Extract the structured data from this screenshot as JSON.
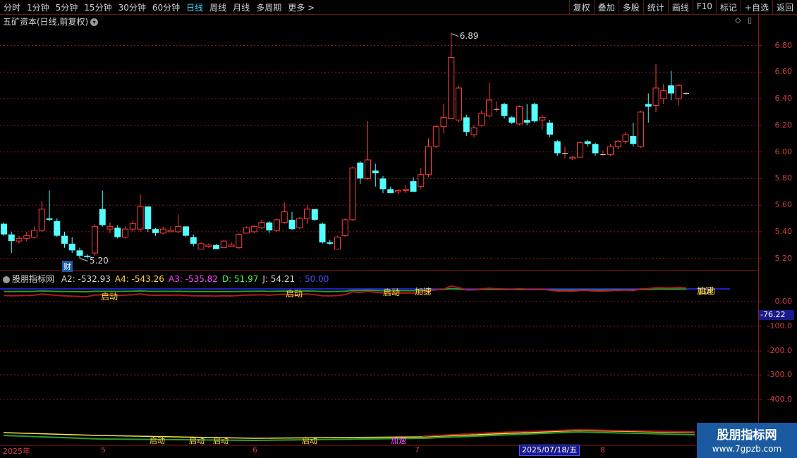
{
  "toolbar": {
    "periods": [
      "分时",
      "1分钟",
      "5分钟",
      "15分钟",
      "30分钟",
      "60分钟",
      "日线",
      "周线",
      "月线",
      "多周期",
      "更多 >"
    ],
    "active_period": "日线",
    "actions": [
      "复权",
      "叠加",
      "多股",
      "统计",
      "画线",
      "F10",
      "标记",
      "+自选",
      "返回"
    ]
  },
  "main_chart": {
    "title": "五矿资本(日线,前复权)",
    "high_label": "6.89",
    "low_label": "5.20",
    "badge": "财",
    "y_labels": [
      "6.80",
      "6.60",
      "6.40",
      "6.20",
      "6.00",
      "5.80",
      "5.60",
      "5.40",
      "5.20"
    ]
  },
  "indicator": {
    "name": "股朋指标网",
    "values": [
      {
        "text": "A2: -532.93",
        "color": "#d8d8d8"
      },
      {
        "text": "A4: -543.26",
        "color": "#ffd84a"
      },
      {
        "text": "A3: -535.82",
        "color": "#ff4aff"
      },
      {
        "text": "D: 51.97",
        "color": "#3fff3f"
      },
      {
        "text": "J: 54.21",
        "color": "#d8d8d8"
      },
      {
        "text": ": 50.00",
        "color": "#4a4aff"
      }
    ],
    "y_labels": [
      "0.00",
      "-100.0",
      "-200.0",
      "-300.0",
      "-400.0"
    ],
    "cursor_value": "-76.22",
    "signals": [
      "启动",
      "启动",
      "启动",
      "加速",
      "加速",
      "启动"
    ]
  },
  "weekly_signals": [
    "启动",
    "启动",
    "启动",
    "启动",
    "加速"
  ],
  "date_axis": {
    "labels": [
      "2025年",
      "5",
      "6",
      "7",
      "8"
    ],
    "cursor_date": "2025/07/18/五"
  },
  "watermark": {
    "name": "股朋指标网",
    "url": "www.7gpzb.com"
  },
  "colors": {
    "up": "#ff3c3c",
    "down": "#54ffff",
    "grid": "#8a1a1a"
  },
  "chart_data": {
    "type": "candlestick",
    "ylim": [
      5.14,
      6.93
    ],
    "candles": [
      [
        5.46,
        5.38,
        5.47,
        5.37
      ],
      [
        5.38,
        5.33,
        5.4,
        5.24
      ],
      [
        5.33,
        5.35,
        5.37,
        5.31
      ],
      [
        5.35,
        5.37,
        5.4,
        5.33
      ],
      [
        5.36,
        5.41,
        5.44,
        5.35
      ],
      [
        5.41,
        5.57,
        5.63,
        5.4
      ],
      [
        5.5,
        5.49,
        5.71,
        5.48
      ],
      [
        5.48,
        5.37,
        5.5,
        5.36
      ],
      [
        5.37,
        5.31,
        5.4,
        5.28
      ],
      [
        5.31,
        5.26,
        5.36,
        5.24
      ],
      [
        5.26,
        5.22,
        5.28,
        5.2
      ],
      [
        5.22,
        5.21,
        5.23,
        5.2
      ],
      [
        5.24,
        5.44,
        5.46,
        5.22
      ],
      [
        5.57,
        5.45,
        5.71,
        5.44
      ],
      [
        5.42,
        5.44,
        5.47,
        5.39
      ],
      [
        5.43,
        5.36,
        5.45,
        5.35
      ],
      [
        5.36,
        5.42,
        5.44,
        5.35
      ],
      [
        5.42,
        5.46,
        5.48,
        5.4
      ],
      [
        5.42,
        5.59,
        5.68,
        5.4
      ],
      [
        5.59,
        5.42,
        5.59,
        5.4
      ],
      [
        5.42,
        5.39,
        5.43,
        5.37
      ],
      [
        5.39,
        5.42,
        5.44,
        5.38
      ],
      [
        5.4,
        5.41,
        5.44,
        5.4
      ],
      [
        5.4,
        5.44,
        5.53,
        5.39
      ],
      [
        5.44,
        5.37,
        5.44,
        5.36
      ],
      [
        5.36,
        5.31,
        5.38,
        5.29
      ],
      [
        5.27,
        5.31,
        5.32,
        5.27
      ],
      [
        5.29,
        5.3,
        5.31,
        5.28
      ],
      [
        5.3,
        5.27,
        5.31,
        5.27
      ],
      [
        5.28,
        5.33,
        5.34,
        5.28
      ],
      [
        5.29,
        5.3,
        5.32,
        5.29
      ],
      [
        5.28,
        5.38,
        5.39,
        5.27
      ],
      [
        5.39,
        5.43,
        5.44,
        5.39
      ],
      [
        5.4,
        5.44,
        5.45,
        5.39
      ],
      [
        5.43,
        5.47,
        5.49,
        5.42
      ],
      [
        5.47,
        5.41,
        5.48,
        5.39
      ],
      [
        5.41,
        5.49,
        5.5,
        5.4
      ],
      [
        5.47,
        5.55,
        5.62,
        5.46
      ],
      [
        5.49,
        5.42,
        5.55,
        5.41
      ],
      [
        5.43,
        5.5,
        5.51,
        5.42
      ],
      [
        5.5,
        5.57,
        5.6,
        5.46
      ],
      [
        5.57,
        5.49,
        5.57,
        5.48
      ],
      [
        5.46,
        5.32,
        5.47,
        5.31
      ],
      [
        5.32,
        5.31,
        5.34,
        5.3
      ],
      [
        5.27,
        5.36,
        5.37,
        5.27
      ],
      [
        5.37,
        5.49,
        5.5,
        5.36
      ],
      [
        5.49,
        5.88,
        5.89,
        5.48
      ],
      [
        5.92,
        5.8,
        5.93,
        5.76
      ],
      [
        5.8,
        5.94,
        6.23,
        5.79
      ],
      [
        5.86,
        5.84,
        5.91,
        5.74
      ],
      [
        5.8,
        5.72,
        5.82,
        5.69
      ],
      [
        5.72,
        5.69,
        5.74,
        5.69
      ],
      [
        5.7,
        5.71,
        5.72,
        5.68
      ],
      [
        5.71,
        5.72,
        5.75,
        5.69
      ],
      [
        5.78,
        5.7,
        5.81,
        5.7
      ],
      [
        5.74,
        5.83,
        5.88,
        5.72
      ],
      [
        5.83,
        6.04,
        6.1,
        5.81
      ],
      [
        6.04,
        6.19,
        6.2,
        6.03
      ],
      [
        6.19,
        6.26,
        6.36,
        6.14
      ],
      [
        6.25,
        6.71,
        6.89,
        6.25
      ],
      [
        6.24,
        6.48,
        6.5,
        6.22
      ],
      [
        6.26,
        6.15,
        6.28,
        6.12
      ],
      [
        6.13,
        6.18,
        6.2,
        6.11
      ],
      [
        6.2,
        6.29,
        6.31,
        6.19
      ],
      [
        6.27,
        6.39,
        6.52,
        6.26
      ],
      [
        6.32,
        6.32,
        6.38,
        6.3
      ],
      [
        6.36,
        6.27,
        6.37,
        6.25
      ],
      [
        6.26,
        6.22,
        6.27,
        6.21
      ],
      [
        6.21,
        6.34,
        6.35,
        6.2
      ],
      [
        6.24,
        6.22,
        6.36,
        6.2
      ],
      [
        6.36,
        6.23,
        6.37,
        6.22
      ],
      [
        6.24,
        6.26,
        6.28,
        6.17
      ],
      [
        6.22,
        6.13,
        6.24,
        6.11
      ],
      [
        6.08,
        5.99,
        6.09,
        5.97
      ],
      [
        5.99,
        5.99,
        6.04,
        5.95
      ],
      [
        5.95,
        5.96,
        5.97,
        5.94
      ],
      [
        5.96,
        6.07,
        6.08,
        5.96
      ],
      [
        6.08,
        6.06,
        6.09,
        6.04
      ],
      [
        6.06,
        5.99,
        6.07,
        5.97
      ],
      [
        5.98,
        5.98,
        6.01,
        5.97
      ],
      [
        5.98,
        6.04,
        6.06,
        5.97
      ],
      [
        6.04,
        6.08,
        6.09,
        6.02
      ],
      [
        6.08,
        6.13,
        6.15,
        6.06
      ],
      [
        6.12,
        6.06,
        6.22,
        6.04
      ],
      [
        6.04,
        6.3,
        6.31,
        6.03
      ],
      [
        6.36,
        6.34,
        6.44,
        6.22
      ],
      [
        6.35,
        6.48,
        6.66,
        6.3
      ],
      [
        6.4,
        6.46,
        6.51,
        6.36
      ],
      [
        6.5,
        6.44,
        6.61,
        6.39
      ],
      [
        6.4,
        6.5,
        6.51,
        6.35
      ],
      [
        6.44,
        6.44,
        6.45,
        6.43
      ]
    ]
  }
}
